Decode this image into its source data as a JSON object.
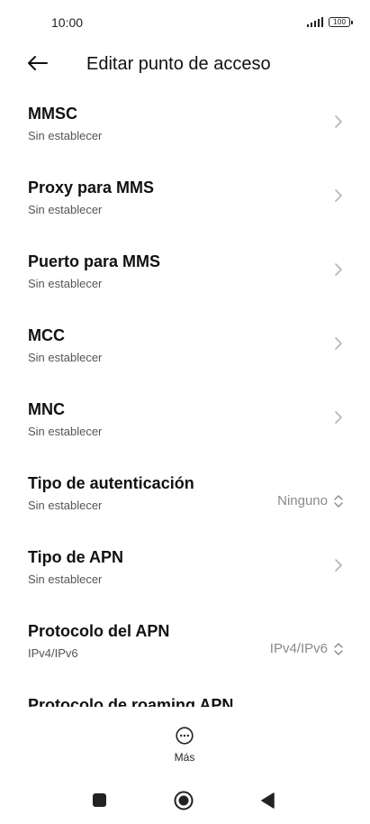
{
  "status_bar": {
    "time": "10:00",
    "battery": "100"
  },
  "header": {
    "title": "Editar punto de acceso",
    "back_icon": "back-arrow-icon"
  },
  "rows": [
    {
      "title": "MMSC",
      "subtitle": "Sin establecer",
      "control": "chevron"
    },
    {
      "title": "Proxy para MMS",
      "subtitle": "Sin establecer",
      "control": "chevron"
    },
    {
      "title": "Puerto para MMS",
      "subtitle": "Sin establecer",
      "control": "chevron"
    },
    {
      "title": "MCC",
      "subtitle": "Sin establecer",
      "control": "chevron"
    },
    {
      "title": "MNC",
      "subtitle": "Sin establecer",
      "control": "chevron"
    },
    {
      "title": "Tipo de autenticación",
      "subtitle": "Sin establecer",
      "value": "Ninguno",
      "control": "dropdown"
    },
    {
      "title": "Tipo de APN",
      "subtitle": "Sin establecer",
      "control": "chevron"
    },
    {
      "title": "Protocolo del APN",
      "subtitle": "IPv4/IPv6",
      "value": "IPv4/IPv6",
      "control": "dropdown"
    },
    {
      "title": "Protocolo de roaming APN",
      "subtitle": "",
      "control": "dropdown"
    }
  ],
  "more": {
    "label": "Más",
    "icon": "more-dots-icon"
  },
  "nav": {
    "recents_icon": "square-icon",
    "home_icon": "circle-icon",
    "back_icon": "triangle-back-icon"
  },
  "colors": {
    "text": "#111111",
    "subtext": "#555555",
    "value": "#8a8a8a",
    "chevron": "#b5b5b5"
  }
}
